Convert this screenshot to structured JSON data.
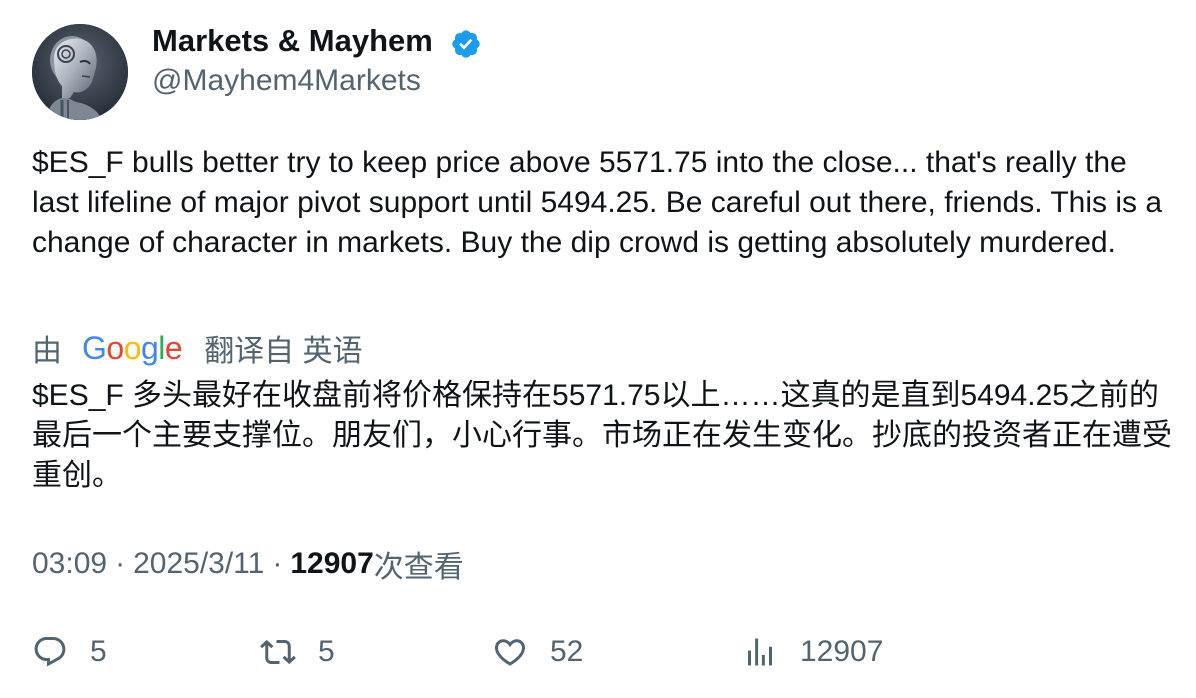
{
  "author": {
    "name": "Markets & Mayhem",
    "handle": "@Mayhem4Markets",
    "verified_icon": "verified-badge-icon",
    "avatar_icon": "robot-avatar"
  },
  "tweet": {
    "text": "$ES_F bulls better try to keep price above 5571.75 into the close... that's really the last lifeline of major pivot support until 5494.25. Be careful out there, friends. This is a change of character in markets. Buy the dip crowd is getting absolutely murdered."
  },
  "translation": {
    "by_label": "由",
    "provider_name": "Google",
    "translated_from": "翻译自 英语",
    "text": "$ES_F 多头最好在收盘前将价格保持在5571.75以上……这真的是直到5494.25之前的最后一个主要支撑位。朋友们，小心行事。市场正在发生变化。抄底的投资者正在遭受重创。"
  },
  "meta": {
    "time": "03:09",
    "separator": "·",
    "date": "2025/3/11",
    "views_count": "12907",
    "views_label": "次查看"
  },
  "actions": {
    "reply_count": "5",
    "retweet_count": "5",
    "like_count": "52",
    "views_count": "12907"
  },
  "colors": {
    "primary_text": "#0f1419",
    "secondary_text": "#536471",
    "verified_blue": "#1d9bf0"
  }
}
